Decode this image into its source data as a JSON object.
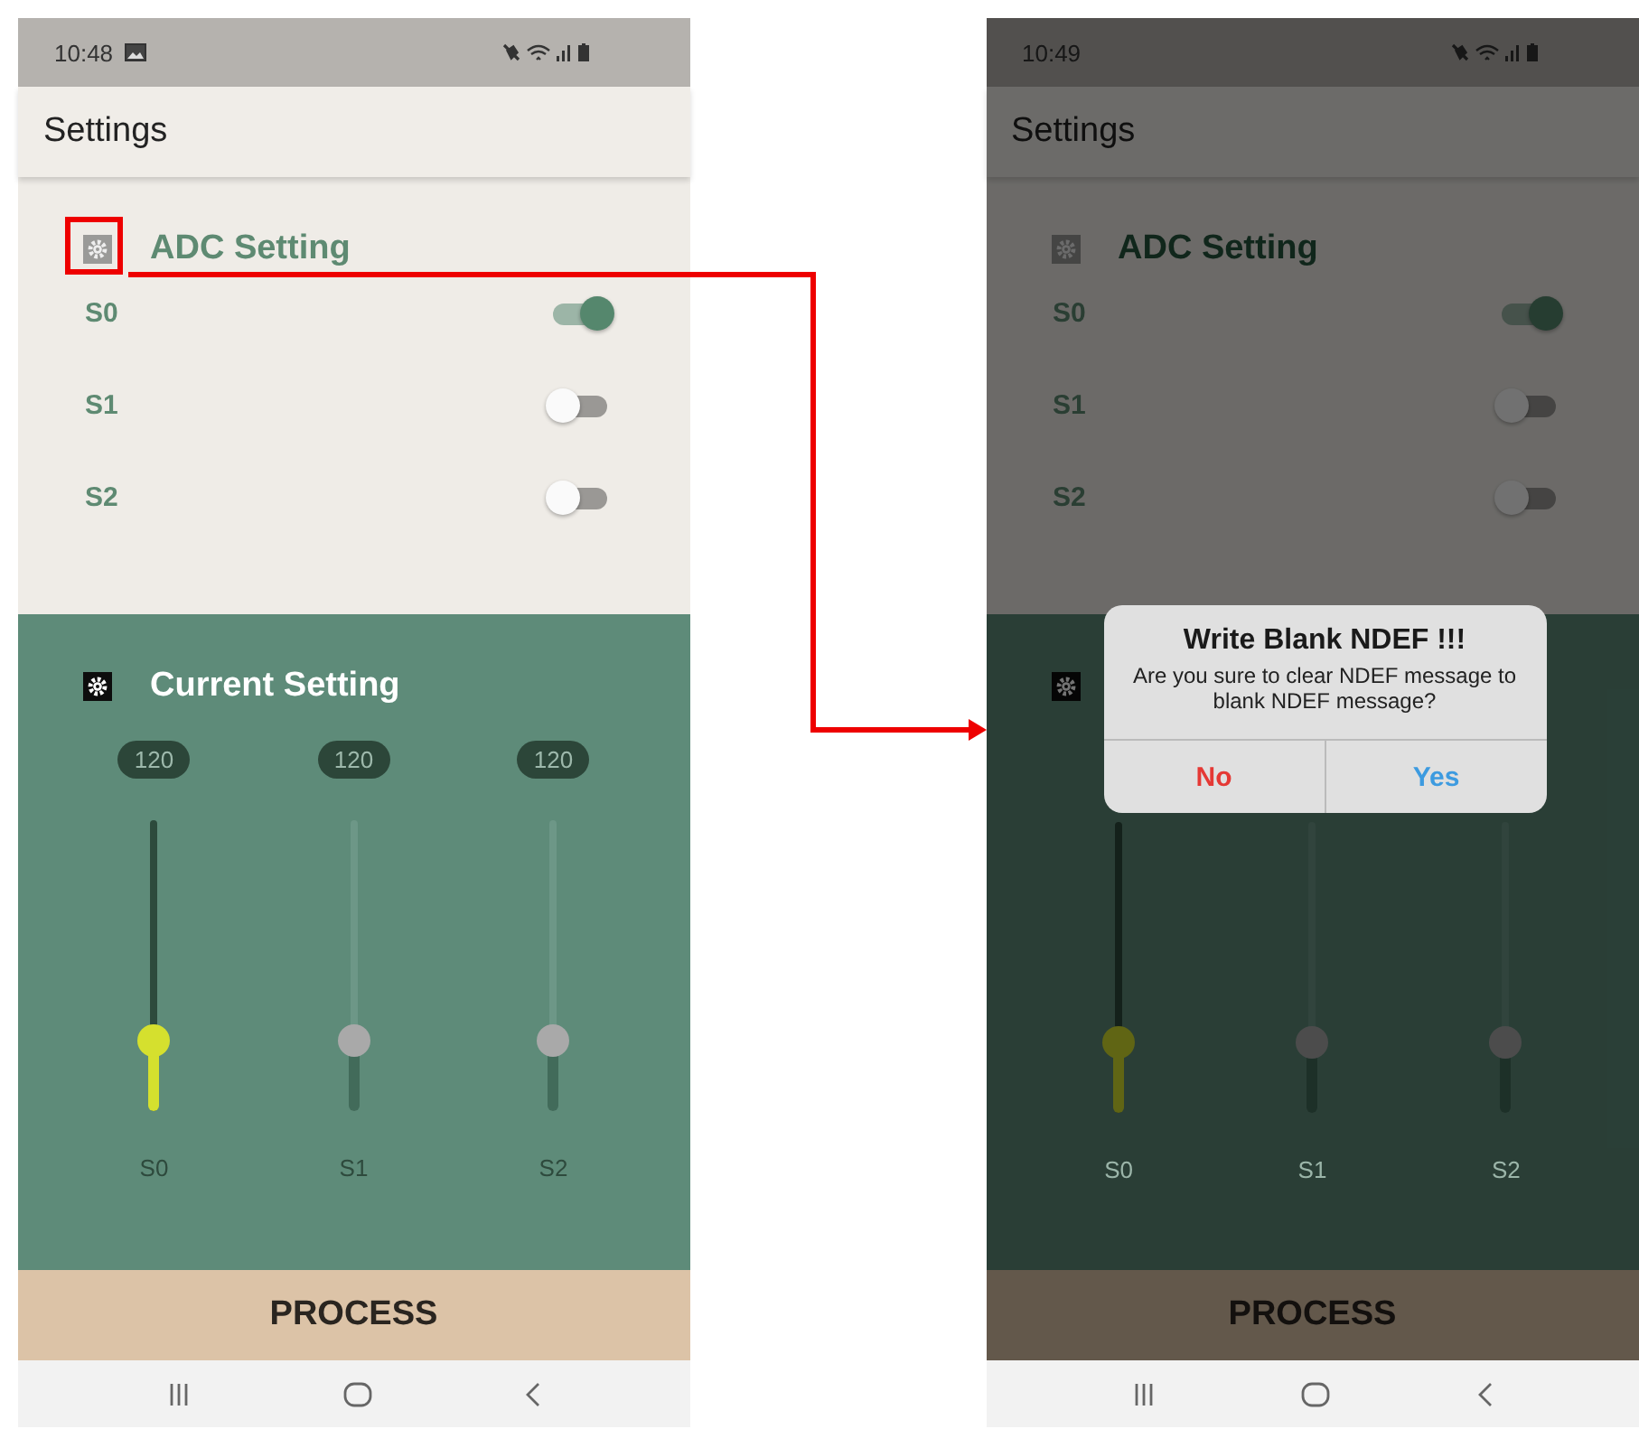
{
  "screens": [
    {
      "dimmed": false,
      "status_bar": {
        "time": "10:48",
        "image_notification": true
      },
      "app_bar": {
        "title": "Settings"
      },
      "adc_setting": {
        "title": "ADC Setting",
        "highlighted": true,
        "switches": [
          {
            "label": "S0",
            "on": true
          },
          {
            "label": "S1",
            "on": false
          },
          {
            "label": "S2",
            "on": false
          }
        ]
      },
      "current_setting": {
        "title": "Current Setting",
        "sliders": [
          {
            "value": "120",
            "label": "S0",
            "enabled": true,
            "level": 0.24
          },
          {
            "value": "120",
            "label": "S1",
            "enabled": false,
            "level": 0.24
          },
          {
            "value": "120",
            "label": "S2",
            "enabled": false,
            "level": 0.24
          }
        ]
      },
      "process_button": "PROCESS"
    },
    {
      "dimmed": true,
      "status_bar": {
        "time": "10:49",
        "image_notification": false
      },
      "app_bar": {
        "title": "Settings"
      },
      "adc_setting": {
        "title": "ADC Setting",
        "highlighted": false,
        "switches": [
          {
            "label": "S0",
            "on": true
          },
          {
            "label": "S1",
            "on": false
          },
          {
            "label": "S2",
            "on": false
          }
        ]
      },
      "current_setting": {
        "sliders": [
          {
            "label": "S0",
            "enabled": true,
            "level": 0.24
          },
          {
            "label": "S1",
            "enabled": false,
            "level": 0.24
          },
          {
            "label": "S2",
            "enabled": false,
            "level": 0.24
          }
        ]
      },
      "process_button": "PROCESS",
      "dialog": {
        "title": "Write Blank NDEF !!!",
        "message": "Are you sure to clear NDEF message to blank NDEF message?",
        "buttons": [
          {
            "label": "No",
            "kind": "negative"
          },
          {
            "label": "Yes",
            "kind": "positive"
          }
        ]
      }
    }
  ]
}
